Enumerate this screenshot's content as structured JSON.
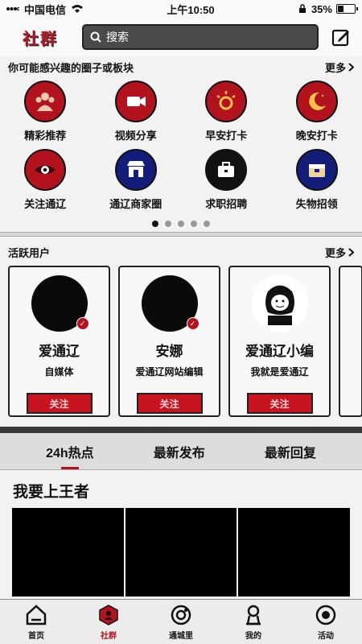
{
  "status": {
    "carrier": "中国电信",
    "time": "上午10:50",
    "battery": "35%",
    "battery_level": 0.35
  },
  "header": {
    "logo": "社群",
    "search_placeholder": "搜索"
  },
  "interest": {
    "title": "你可能感兴趣的圈子或板块",
    "more": "更多",
    "items": [
      {
        "label": "精彩推荐",
        "icon": "people-icon",
        "color": "red"
      },
      {
        "label": "视频分享",
        "icon": "video-camera-icon",
        "color": "red"
      },
      {
        "label": "早安打卡",
        "icon": "sun-icon",
        "color": "red"
      },
      {
        "label": "晚安打卡",
        "icon": "moon-icon",
        "color": "red"
      },
      {
        "label": "关注通辽",
        "icon": "eye-icon",
        "color": "red"
      },
      {
        "label": "通辽商家圈",
        "icon": "shop-icon",
        "color": "blue"
      },
      {
        "label": "求职招聘",
        "icon": "briefcase-icon",
        "color": "black"
      },
      {
        "label": "失物招领",
        "icon": "box-icon",
        "color": "blue"
      }
    ],
    "page_count": 5,
    "page_active": 1
  },
  "users": {
    "title": "活跃用户",
    "more": "更多",
    "list": [
      {
        "name": "爱通辽",
        "desc": "自媒体",
        "button": "关注"
      },
      {
        "name": "安娜",
        "desc": "爱通辽网站编辑",
        "button": "关注"
      },
      {
        "name": "爱通辽小编",
        "desc": "我就是爱通辽",
        "button": "关注"
      }
    ]
  },
  "tabs": [
    {
      "label": "24h热点"
    },
    {
      "label": "最新发布"
    },
    {
      "label": "最新回复"
    }
  ],
  "post": {
    "title": "我要上王者"
  },
  "nav": [
    {
      "label": "首页",
      "icon": "home-icon"
    },
    {
      "label": "社群",
      "icon": "community-icon"
    },
    {
      "label": "通城里",
      "icon": "city-icon"
    },
    {
      "label": "我的",
      "icon": "user-icon"
    },
    {
      "label": "活动",
      "icon": "activity-icon"
    }
  ]
}
